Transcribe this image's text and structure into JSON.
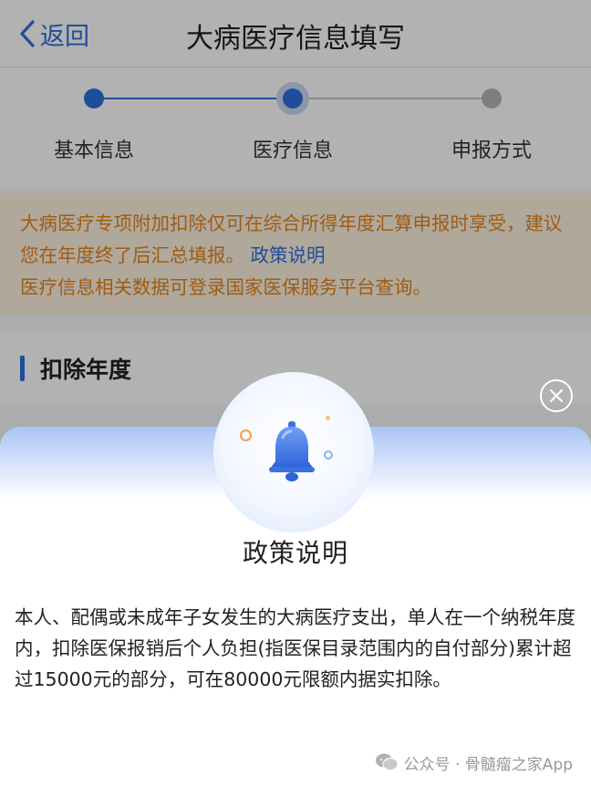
{
  "navbar": {
    "back_label": "返回",
    "title": "大病医疗信息填写",
    "accent_color": "#2f6fdc"
  },
  "steps": [
    {
      "label": "基本信息",
      "state": "done"
    },
    {
      "label": "医疗信息",
      "state": "current"
    },
    {
      "label": "申报方式",
      "state": "todo"
    }
  ],
  "notice": {
    "text_part1": "大病医疗专项附加扣除仅可在综合所得年度汇算申报时享受，建议您在年度终了后汇总填报。",
    "link_label": "政策说明",
    "text_part2": "医疗信息相关数据可登录国家医保服务平台查询。"
  },
  "section": {
    "title": "扣除年度"
  },
  "modal": {
    "title": "政策说明",
    "body": "本人、配偶或未成年子女发生的大病医疗支出，单人在一个纳税年度内，扣除医保报销后个人负担(指医保目录范围内的自付部分)累计超过15000元的部分，可在80000元限额内据实扣除。",
    "close_icon": "close-circle-icon",
    "illustration_icon": "bell-icon"
  },
  "watermark": {
    "text": "公众号 · 骨髓瘤之家App",
    "icon": "wechat-icon"
  }
}
